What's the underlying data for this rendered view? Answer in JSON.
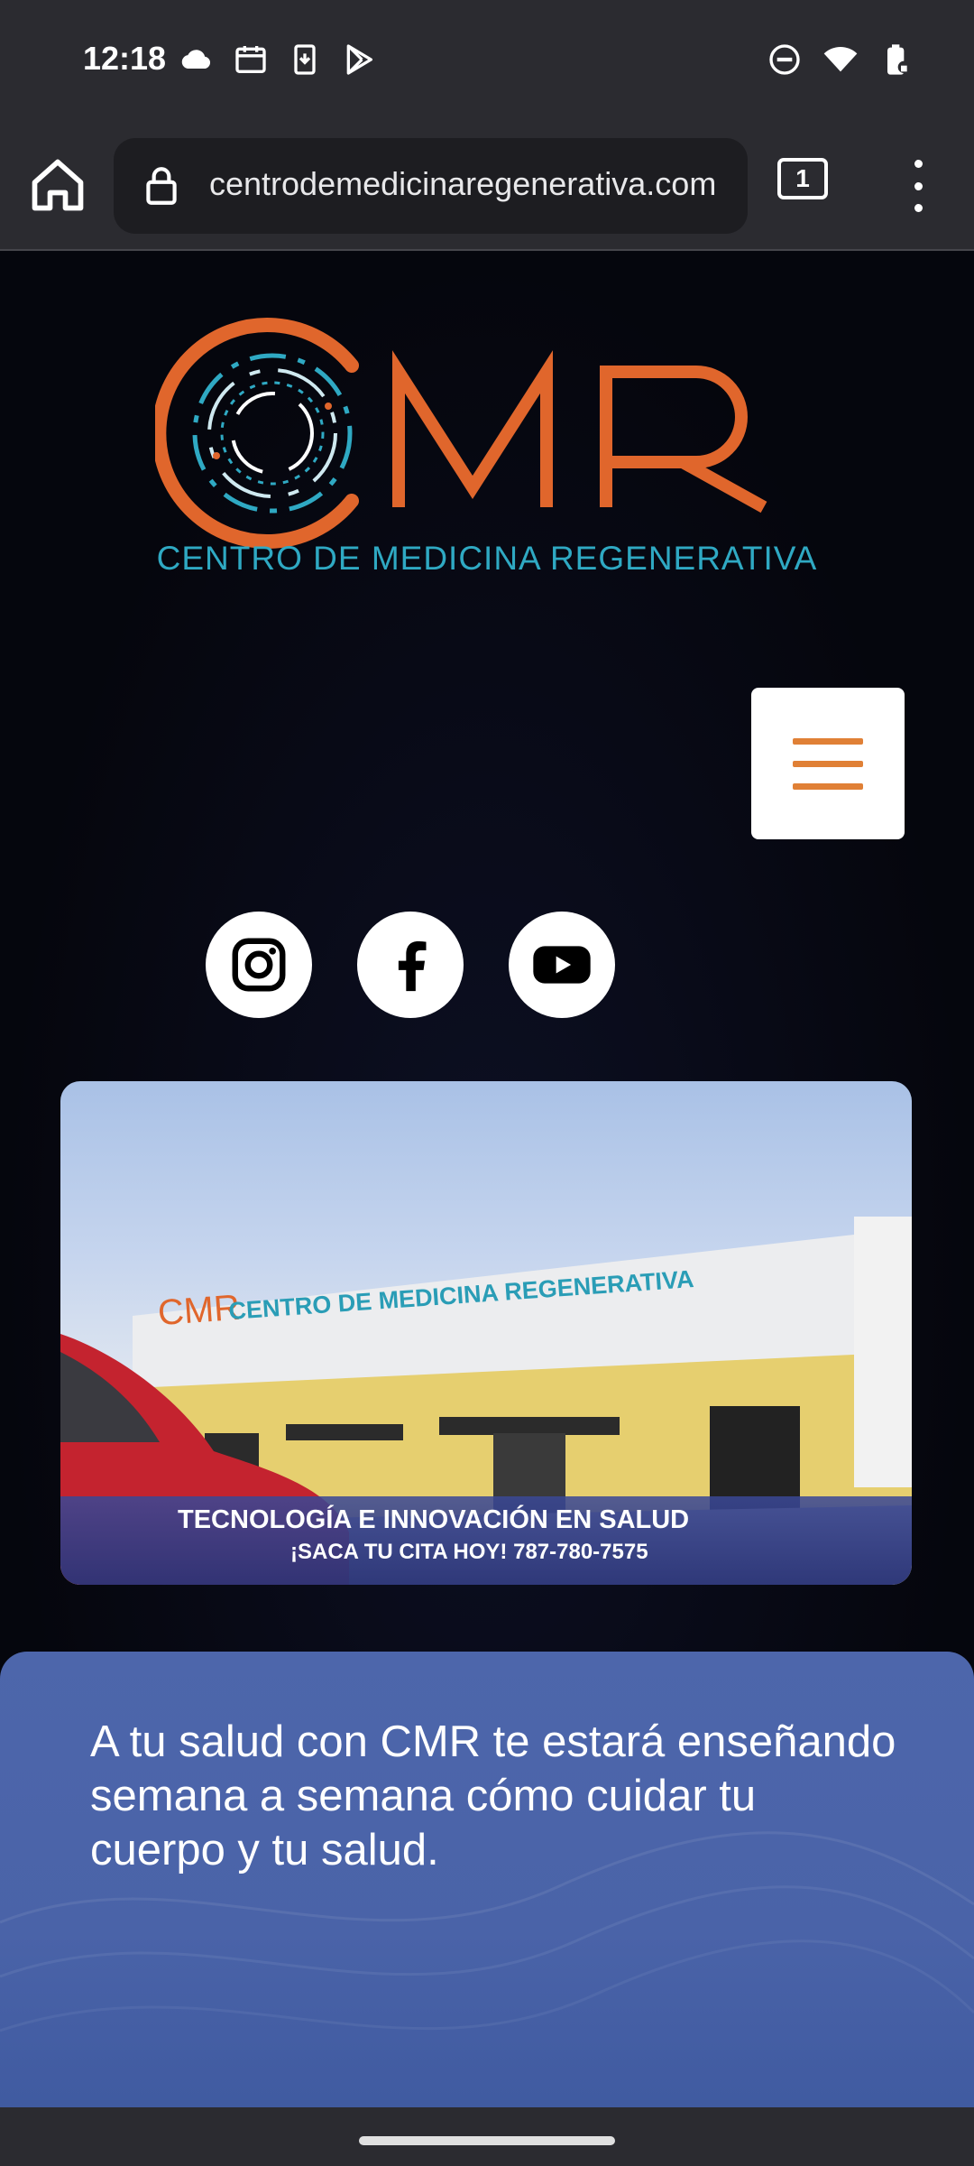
{
  "status_bar": {
    "time": "12:18",
    "left_icons": [
      "cloud-icon",
      "calendar-icon",
      "download-icon",
      "play-store-icon"
    ],
    "right_icons": [
      "do-not-disturb-icon",
      "wifi-icon",
      "battery-icon"
    ]
  },
  "browser": {
    "url": "centrodemedicinaregenerativa.com",
    "tab_count": "1"
  },
  "site": {
    "logo_text": "CMR",
    "logo_tagline": "CENTRO DE MEDICINA REGENERATIVA",
    "social": [
      "instagram",
      "facebook",
      "youtube"
    ],
    "video": {
      "sign_text": "CENTRO DE MEDICINA REGENERATIVA",
      "caption_line1": "TECNOLOGÍA E INNOVACIÓN EN SALUD",
      "caption_line2": "¡SACA TU CITA HOY!  787-780-7575"
    },
    "promo_text": "A tu salud con CMR te estará enseñando semana a semana cómo cuidar tu cuerpo y tu salud."
  },
  "colors": {
    "brand_orange": "#e0662c",
    "brand_teal": "#2fa9c3",
    "promo_blue": "#4d66ab"
  }
}
